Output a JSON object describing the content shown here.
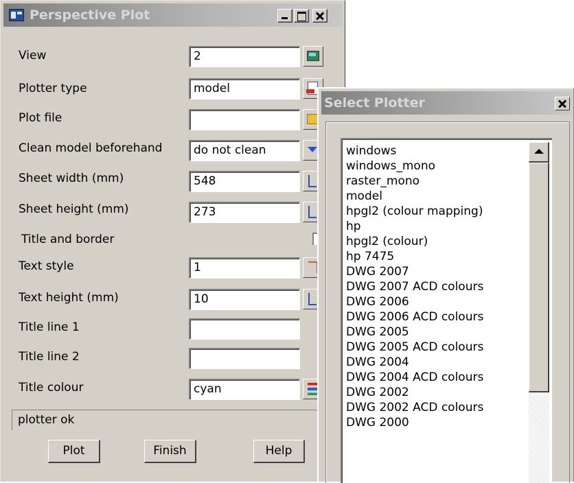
{
  "perspective_dialog": {
    "title": "Perspective Plot",
    "fields": {
      "view": {
        "label": "View",
        "value": "2"
      },
      "plotter_type": {
        "label": "Plotter type",
        "value": "model"
      },
      "plot_file": {
        "label": "Plot file",
        "value": ""
      },
      "clean_model": {
        "label": "Clean model beforehand",
        "value": "do not clean"
      },
      "sheet_width": {
        "label": "Sheet width  (mm)",
        "value": "548"
      },
      "sheet_height": {
        "label": "Sheet height (mm)",
        "value": "273"
      },
      "title_and_border": {
        "label": "Title and border"
      },
      "text_style": {
        "label": "Text style",
        "value": "1"
      },
      "text_height": {
        "label": "Text height (mm)",
        "value": "10"
      },
      "title_line_1": {
        "label": "Title line 1",
        "value": ""
      },
      "title_line_2": {
        "label": "Title line 2",
        "value": ""
      },
      "title_colour": {
        "label": "Title colour",
        "value": "cyan"
      }
    },
    "status": "plotter ok",
    "buttons": {
      "plot": "Plot",
      "finish": "Finish",
      "help": "Help"
    }
  },
  "select_plotter": {
    "title": "Select Plotter",
    "items": [
      "windows",
      "windows_mono",
      "raster_mono",
      "model",
      "hpgl2 (colour mapping)",
      "hp",
      "hpgl2 (colour)",
      "hp 7475",
      "DWG 2007",
      "DWG 2007 ACD colours",
      "DWG 2006",
      "DWG 2006 ACD colours",
      "DWG 2005",
      "DWG 2005 ACD colours",
      "DWG 2004",
      "DWG 2004 ACD colours",
      "DWG 2002",
      "DWG 2002 ACD colours",
      "DWG 2000"
    ]
  }
}
